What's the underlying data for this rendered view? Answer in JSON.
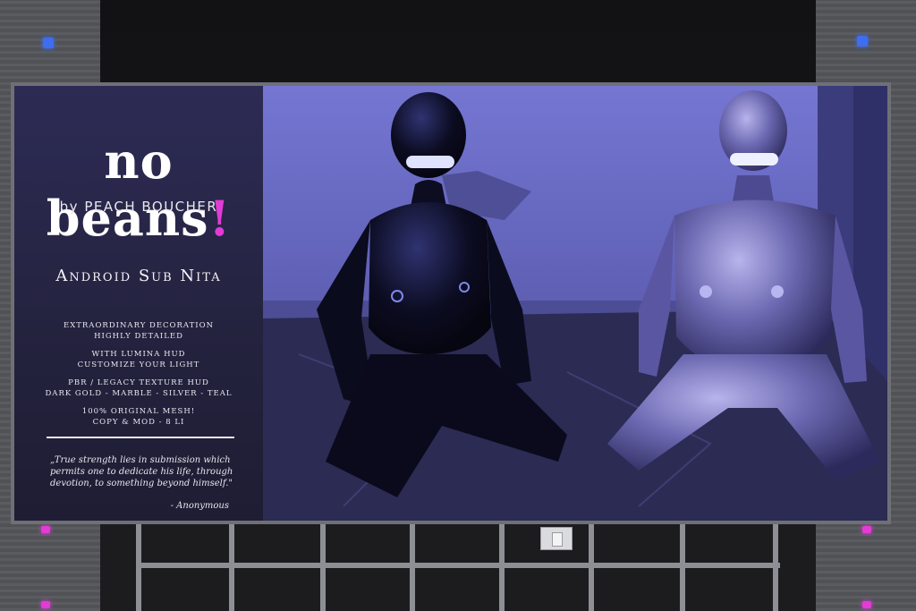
{
  "poster": {
    "brand_text": "no beans",
    "brand_punct": "!",
    "byline": "by PEACH BOUCHER",
    "product_name": "Android Sub Nita",
    "features": [
      [
        "EXTRAORDINARY DECORATION",
        "HIGHLY DETAILED"
      ],
      [
        "WITH LUMINA HUD",
        "CUSTOMIZE YOUR LIGHT"
      ],
      [
        "PBR / LEGACY TEXTURE HUD",
        "DARK GOLD - MARBLE - SILVER - TEAL"
      ],
      [
        "100% ORIGINAL MESH!",
        "COPY & MOD - 8 LI"
      ]
    ],
    "quote": "„True strength lies in submission which permits one to dedicate his life, through devotion, to something beyond himself.\"",
    "quote_author": "- Anonymous"
  },
  "colors": {
    "accent_pink": "#e23bd6",
    "led_blue": "#3f6df0",
    "scene_wall": "#6e70c9",
    "panel_bg": "#2d2b55"
  }
}
